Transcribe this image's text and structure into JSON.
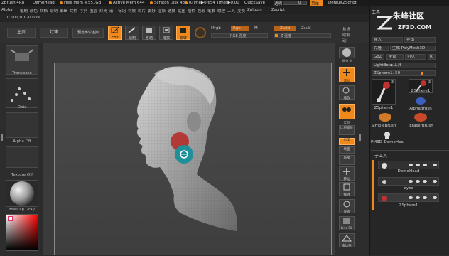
{
  "title_bar": {
    "app": "ZBrush 4R8",
    "doc": "DemoHead",
    "free_mem": "Free Mem 4.551GB",
    "active_mem": "Active Mem 644",
    "scratch": "Scratch Disk 48",
    "timer": "RTime▶0.654 Timer▶0.00",
    "quicksave": "QuickSave",
    "transparency": "透明",
    "transparency_value": "0",
    "menu_btn": "菜单",
    "script": "DefaultZScript"
  },
  "menu_bar": [
    "Alpha",
    "笔刷",
    "颜色",
    "文档",
    "绘制",
    "编辑",
    "文件",
    "序列",
    "图层",
    "灯光",
    "宏",
    "标记",
    "材质",
    "影片",
    "偏好",
    "渲染",
    "选择",
    "贴图",
    "插件",
    "色彩",
    "笔触",
    "纹理",
    "工具",
    "变换",
    "Zplugin",
    "Zscript"
  ],
  "coords": "0.001,0.1,-0.039",
  "toolbar": {
    "home": "主页",
    "lightbox": "灯箱",
    "preview": "预览布尔渲染",
    "edit": "Edit",
    "draw": "绘制",
    "move": "移动",
    "scale": "缩放",
    "rotate": "旋转",
    "mrgb": "Mrgb",
    "rgb": "Rgb",
    "m": "M",
    "zadd": "Zadd",
    "zsub": "Zsub",
    "rgb_intensity": "RGB 强度",
    "z_intensity": "Z 强度",
    "focal_shift": "焦点",
    "draw_size": "绘制",
    "dynamic": "动"
  },
  "left_shelf": {
    "brush": "Transpose",
    "stroke": "Dots",
    "alpha": "Alpha Off",
    "texture": "Texture Off",
    "material": "MatCap Gray"
  },
  "right_shelf": [
    "SPix 3",
    "滚动",
    "缩放",
    "实际",
    "比例缩放",
    "透视",
    "地面",
    "局部",
    "XYZ",
    "移动",
    "缩放",
    "旋转",
    "Line Fill",
    "多边形"
  ],
  "right_panel": {
    "tool_header": "工具",
    "load": "加载工具",
    "save": "另存为",
    "import": "导入",
    "export": "导出",
    "clone": "克隆",
    "polymesh": "生成 PolyMesh3D",
    "goz": "GoZ",
    "all": "全部",
    "visible": "可见",
    "r": "R",
    "lightbox_tool": "LightBox▶工具",
    "zsphere_label": "ZSphere1. 50",
    "tools": [
      {
        "name": "ZSphere1",
        "count": "3"
      },
      {
        "name": "ZSphere1",
        "count": "3"
      },
      {
        "name": "AlphaBrush",
        "count": ""
      },
      {
        "name": "SimpleBrush",
        "count": ""
      },
      {
        "name": "EraserBrush",
        "count": ""
      },
      {
        "name": "PM3D_DemoHea",
        "count": ""
      }
    ],
    "subtool_header": "子工具",
    "subtools": [
      "DemoHead",
      "eyes",
      "ZSphere1"
    ],
    "watermark_cn": "朱峰社区",
    "watermark_en": "ZF3D.COM"
  },
  "colors": {
    "accent": "#f0891c",
    "panel_bg": "#262626",
    "canvas_bg": "#3b3b3b"
  }
}
